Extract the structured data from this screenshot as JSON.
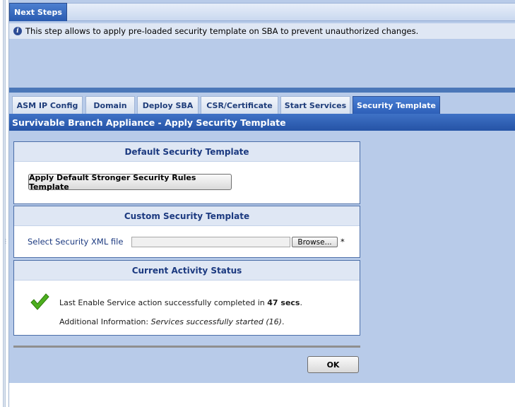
{
  "next_steps": {
    "tab_label": "Next Steps",
    "info_text": "This step allows to apply pre-loaded security template on SBA to prevent unauthorized changes."
  },
  "tabs": [
    {
      "label": "ASM IP Config",
      "active": false
    },
    {
      "label": "Domain",
      "active": false
    },
    {
      "label": "Deploy SBA",
      "active": false
    },
    {
      "label": "CSR/Certificate",
      "active": false
    },
    {
      "label": "Start Services",
      "active": false
    },
    {
      "label": "Security Template",
      "active": true
    }
  ],
  "section_title": "Survivable Branch Appliance - Apply Security Template",
  "default_template": {
    "heading": "Default Security Template",
    "button_label": "Apply Default Stronger Security Rules Template"
  },
  "custom_template": {
    "heading": "Custom Security Template",
    "field_label": "Select Security XML file",
    "file_value": "",
    "browse_label": "Browse...",
    "required_mark": "*"
  },
  "activity": {
    "heading": "Current Activity Status",
    "status_prefix": "Last Enable Service action successfully completed in",
    "status_duration": "47 secs",
    "status_suffix": ".",
    "additional_label": "Additional Information:",
    "additional_value": "Services successfully started (16)",
    "additional_suffix": "."
  },
  "ok_label": "OK",
  "colors": {
    "accent": "#2d5fb8",
    "panel_bg": "#b8cbe9",
    "heading_text": "#1c3a80",
    "check_green": "#4caf1e"
  }
}
